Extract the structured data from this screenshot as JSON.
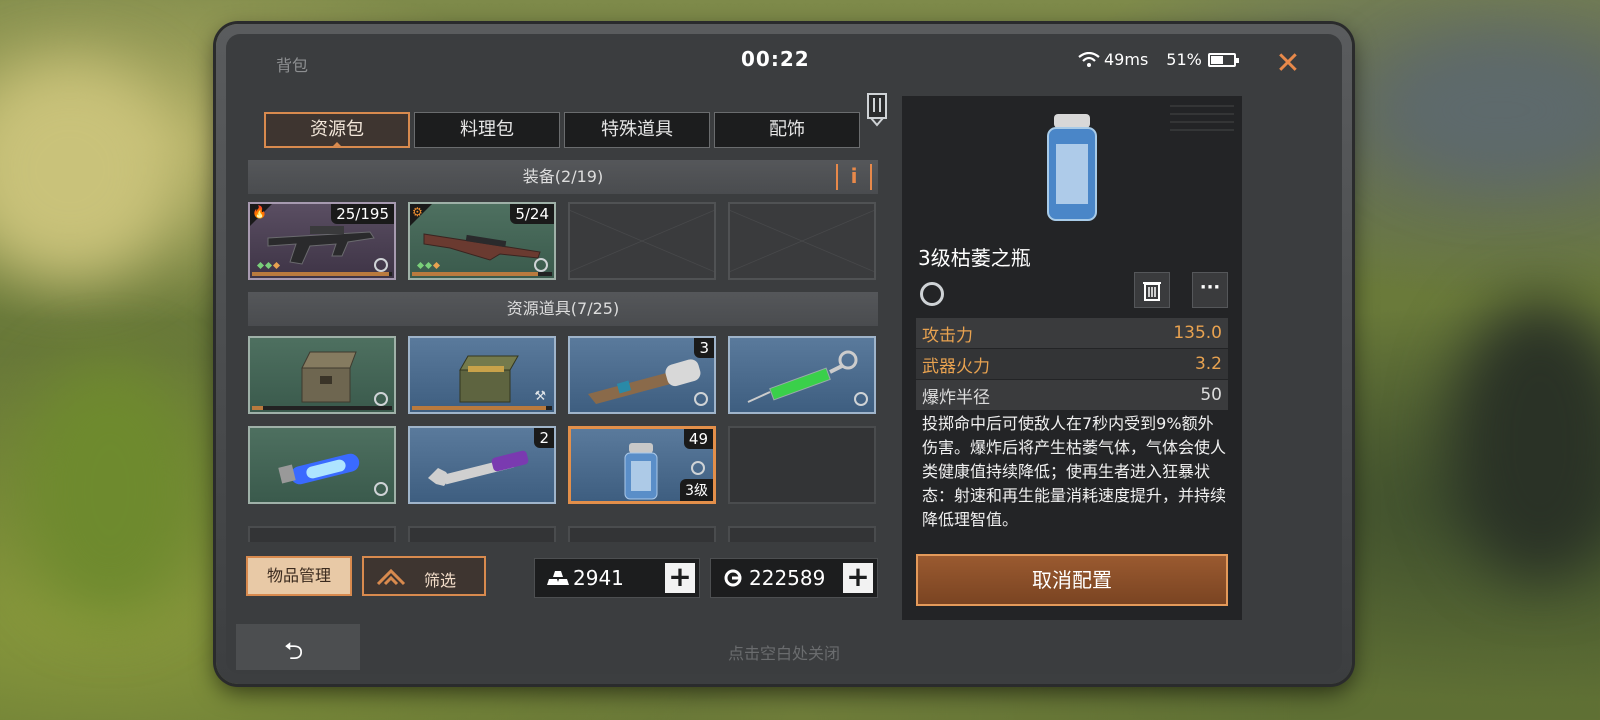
{
  "window": {
    "title": "背包",
    "timer": "00:22",
    "ping": "49ms",
    "battery": "51%",
    "battery_level": 0.51
  },
  "tabs": [
    "资源包",
    "料理包",
    "特殊道具",
    "配饰"
  ],
  "active_tab": 0,
  "equipment": {
    "header": "装备(2/19)",
    "slots": [
      {
        "kind": "weapon-smg",
        "count": "25/195",
        "rarity": "purple",
        "durability": 0.98
      },
      {
        "kind": "weapon-rifle",
        "count": "5/24",
        "rarity": "green",
        "durability": 0.9
      },
      {
        "kind": "empty"
      },
      {
        "kind": "empty"
      }
    ]
  },
  "resources": {
    "header": "资源道具(7/25)",
    "slots": [
      {
        "kind": "crate",
        "rarity": "green"
      },
      {
        "kind": "ammo-crate",
        "rarity": "blue"
      },
      {
        "kind": "flashlight",
        "rarity": "blue",
        "count": "3"
      },
      {
        "kind": "syringe",
        "rarity": "blue"
      },
      {
        "kind": "energy-tube",
        "rarity": "green"
      },
      {
        "kind": "wrench",
        "rarity": "blue",
        "count": "2"
      },
      {
        "kind": "bottle",
        "rarity": "selected",
        "count": "49",
        "level": "3级"
      },
      {
        "kind": "empty"
      }
    ]
  },
  "buttons": {
    "manage": "物品管理",
    "filter": "筛选",
    "cancel": "取消配置"
  },
  "currency": {
    "gold": "2941",
    "coins": "222589"
  },
  "hint": "点击空白处关闭",
  "detail": {
    "name": "3级枯萎之瓶",
    "stats": [
      {
        "label": "攻击力",
        "value": "135.0",
        "highlight": true
      },
      {
        "label": "武器火力",
        "value": "3.2",
        "highlight": true
      },
      {
        "label": "爆炸半径",
        "value": "50",
        "highlight": false
      }
    ],
    "description": "投掷命中后可使敌人在7秒内受到9%额外伤害。爆炸后将产生枯萎气体，气体会使人类健康值持续降低；使再生者进入狂暴状态：射速和再生能量消耗速度提升，并持续降低理智值。"
  },
  "colors": {
    "accent": "#d88a4e",
    "stat_highlight": "#e8a250",
    "green_rarity": "#4e7060",
    "blue_rarity": "#5a7a9c"
  }
}
